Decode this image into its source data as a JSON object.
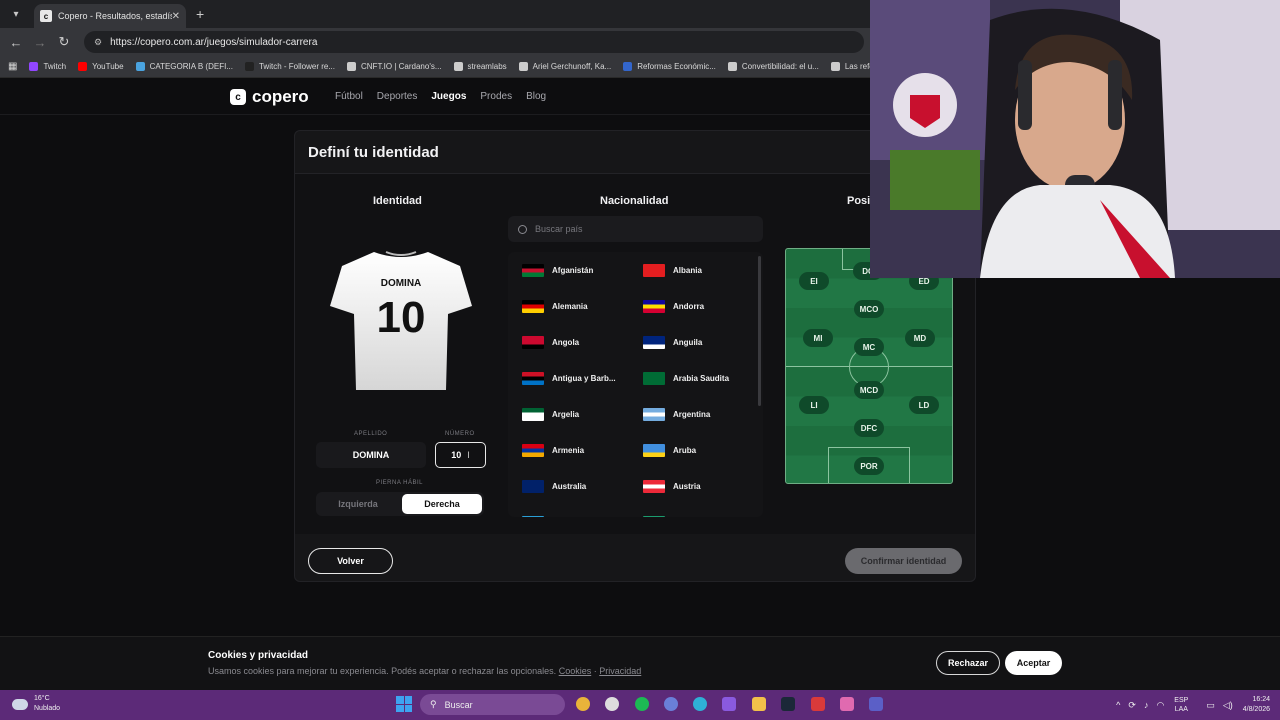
{
  "browser": {
    "tab_title": "Copero - Resultados, estadístic",
    "url": "https://copero.com.ar/juegos/simulador-carrera",
    "bookmarks": [
      {
        "label": "Twitch",
        "color": "#9146ff"
      },
      {
        "label": "YouTube",
        "color": "#ff0000"
      },
      {
        "label": "CATEGORIA B (DEFI...",
        "color": "#4aa3df"
      },
      {
        "label": "Twitch - Follower re...",
        "color": "#222222"
      },
      {
        "label": "CNFT.IO | Cardano's...",
        "color": "#cccccc"
      },
      {
        "label": "streamlabs",
        "color": "#cccccc"
      },
      {
        "label": "Ariel Gerchunoff, Ka...",
        "color": "#cccccc"
      },
      {
        "label": "Reformas Económic...",
        "color": "#3366cc"
      },
      {
        "label": "Convertibilidad: el u...",
        "color": "#cccccc"
      },
      {
        "label": "Las refor",
        "color": "#cccccc"
      }
    ]
  },
  "site": {
    "logo": "copero",
    "nav": [
      "Fútbol",
      "Deportes",
      "Juegos",
      "Prodes",
      "Blog"
    ],
    "active_nav": "Juegos"
  },
  "card": {
    "title": "Definí tu identidad",
    "col_identidad": "Identidad",
    "col_nacionalidad": "Nacionalidad",
    "col_posicion": "Posi",
    "jersey_name": "DOMINA",
    "jersey_number": "10",
    "apellido_label": "APELLIDO",
    "apellido_value": "DOMINA",
    "numero_label": "NÚMERO",
    "numero_value": "10",
    "pierna_label": "PIERNA HÁBIL",
    "pierna_left": "Izquierda",
    "pierna_right": "Derecha",
    "search_placeholder": "Buscar país",
    "btn_back": "Volver",
    "btn_confirm": "Confirmar identidad"
  },
  "countries": [
    {
      "name": "Afganistán",
      "flag": [
        "#000000",
        "#c8102e",
        "#007a36"
      ]
    },
    {
      "name": "Albania",
      "flag": [
        "#e41e20",
        "#e41e20",
        "#e41e20"
      ]
    },
    {
      "name": "Alemania",
      "flag": [
        "#000000",
        "#dd0000",
        "#ffce00"
      ]
    },
    {
      "name": "Andorra",
      "flag": [
        "#10069f",
        "#fedd00",
        "#d50032"
      ]
    },
    {
      "name": "Angola",
      "flag": [
        "#cc092f",
        "#cc092f",
        "#000000"
      ]
    },
    {
      "name": "Anguila",
      "flag": [
        "#00247d",
        "#00247d",
        "#ffffff"
      ]
    },
    {
      "name": "Antigua y Barb...",
      "flag": [
        "#ce1126",
        "#000000",
        "#0072c6"
      ]
    },
    {
      "name": "Arabia Saudita",
      "flag": [
        "#006c35",
        "#006c35",
        "#006c35"
      ]
    },
    {
      "name": "Argelia",
      "flag": [
        "#006233",
        "#ffffff",
        "#ffffff"
      ]
    },
    {
      "name": "Argentina",
      "flag": [
        "#74acdf",
        "#ffffff",
        "#74acdf"
      ]
    },
    {
      "name": "Armenia",
      "flag": [
        "#d90012",
        "#0033a0",
        "#f2a800"
      ]
    },
    {
      "name": "Aruba",
      "flag": [
        "#418fde",
        "#418fde",
        "#fcd116"
      ]
    },
    {
      "name": "Australia",
      "flag": [
        "#012169",
        "#012169",
        "#012169"
      ]
    },
    {
      "name": "Austria",
      "flag": [
        "#ed2939",
        "#ffffff",
        "#ed2939"
      ]
    }
  ],
  "positions": [
    "DC",
    "EI",
    "ED",
    "MCO",
    "MI",
    "MC",
    "MD",
    "MCD",
    "LI",
    "LD",
    "DFC",
    "POR"
  ],
  "cookie": {
    "title": "Cookies y privacidad",
    "text": "Usamos cookies para mejorar tu experiencia. Podés aceptar o rechazar las opcionales.",
    "link_cookies": "Cookies",
    "sep": "·",
    "link_privacy": "Privacidad",
    "btn_reject": "Rechazar",
    "btn_accept": "Aceptar"
  },
  "taskbar": {
    "temp": "16°C",
    "weather": "Nublado",
    "search": "Buscar",
    "lang1": "ESP",
    "lang2": "LAA",
    "time": "16:24",
    "date": "4/8/2026"
  }
}
